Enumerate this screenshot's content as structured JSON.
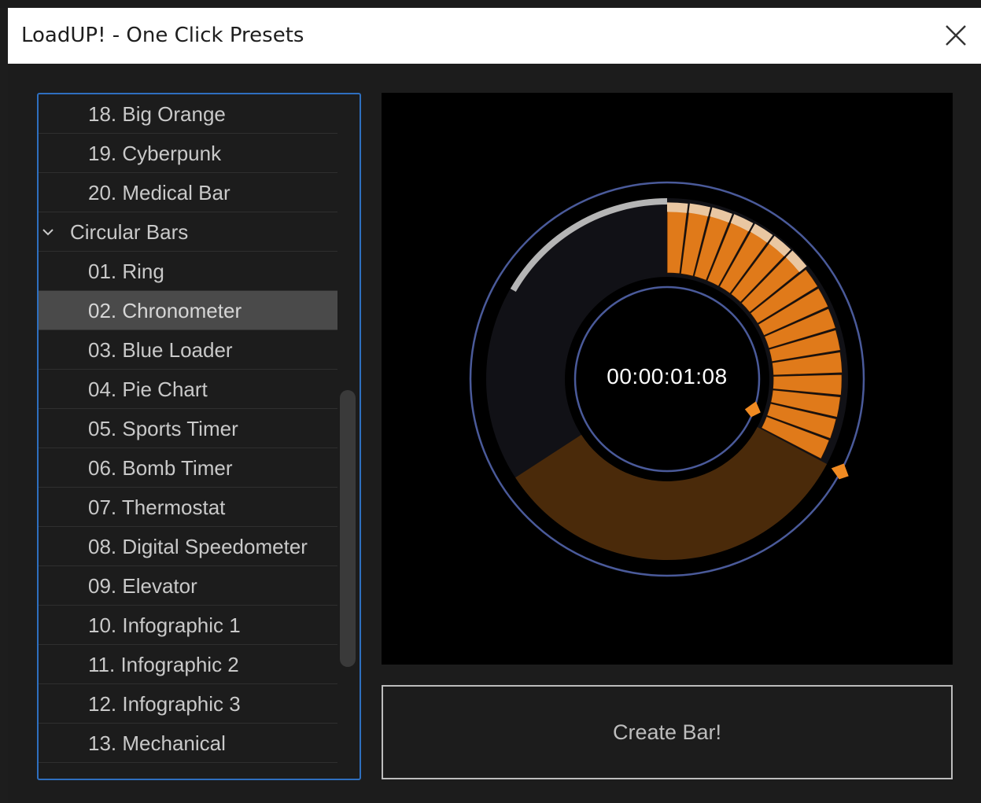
{
  "window": {
    "title": "LoadUP! - One Click Presets",
    "close_icon": "close-icon"
  },
  "tree": {
    "items": [
      {
        "label": "18. Big Orange",
        "type": "item"
      },
      {
        "label": "19. Cyberpunk",
        "type": "item"
      },
      {
        "label": "20. Medical Bar",
        "type": "item"
      },
      {
        "label": "Circular Bars",
        "type": "group",
        "expanded": true
      },
      {
        "label": "01. Ring",
        "type": "item"
      },
      {
        "label": "02. Chronometer",
        "type": "item",
        "selected": true
      },
      {
        "label": "03. Blue Loader",
        "type": "item"
      },
      {
        "label": "04. Pie Chart",
        "type": "item"
      },
      {
        "label": "05. Sports Timer",
        "type": "item"
      },
      {
        "label": "06. Bomb Timer",
        "type": "item"
      },
      {
        "label": "07. Thermostat",
        "type": "item"
      },
      {
        "label": "08. Digital Speedometer",
        "type": "item"
      },
      {
        "label": "09. Elevator",
        "type": "item"
      },
      {
        "label": "10. Infographic 1",
        "type": "item"
      },
      {
        "label": "11. Infographic 2",
        "type": "item"
      },
      {
        "label": "12. Infographic 3",
        "type": "item"
      },
      {
        "label": "13. Mechanical",
        "type": "item"
      }
    ]
  },
  "preview": {
    "timecode": "00:00:01:08",
    "progress": 0.42,
    "accent_color": "#e07a1a",
    "ring_color": "#4a5a9a"
  },
  "actions": {
    "create_label": "Create Bar!"
  },
  "colors": {
    "selection": "#4a4a4a",
    "focus_border": "#2e6fbf"
  }
}
